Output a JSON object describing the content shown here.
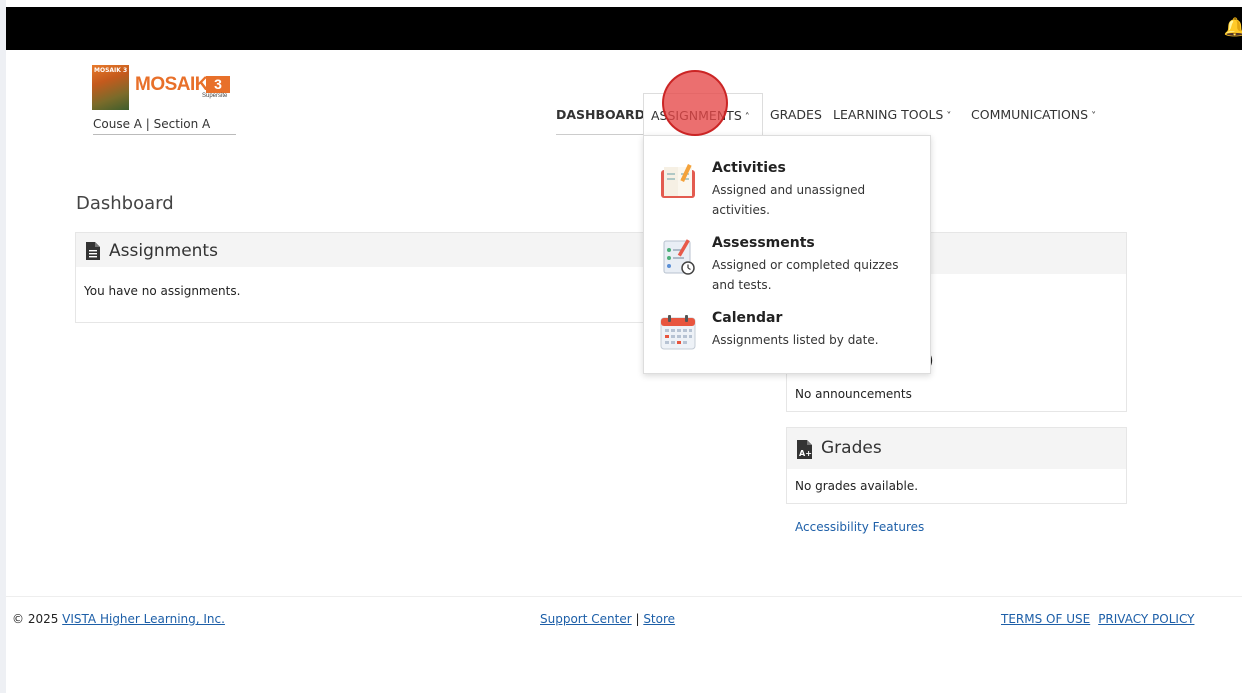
{
  "header": {
    "logo_cover_text": "MOSAIK 3",
    "brand_name": "MOSAIK",
    "brand_number": "3",
    "brand_sub": "Supersite",
    "course_label": "Couse A | Section A"
  },
  "nav": {
    "dashboard": "DASHBOARD",
    "assignments": "ASSIGNMENTS",
    "grades": "GRADES",
    "learning_tools": "LEARNING TOOLS",
    "communications": "COMMUNICATIONS"
  },
  "dropdown": {
    "items": [
      {
        "title": "Activities",
        "desc": "Assigned and unassigned activities.",
        "icon": "activities-book-icon"
      },
      {
        "title": "Assessments",
        "desc": "Assigned or completed quizzes and tests.",
        "icon": "assessments-checklist-icon"
      },
      {
        "title": "Calendar",
        "desc": "Assignments listed by date.",
        "icon": "calendar-icon"
      }
    ]
  },
  "main": {
    "page_title": "Dashboard",
    "assignments_panel": {
      "title": "Assignments",
      "empty": "You have no assignments."
    },
    "announcements_panel": {
      "title_fragment": ")",
      "empty": "No announcements"
    },
    "grades_panel": {
      "title": "Grades",
      "empty": "No grades available."
    },
    "accessibility_link": "Accessibility Features"
  },
  "footer": {
    "copyright_prefix": "© 2025 ",
    "company_link": "VISTA Higher Learning, Inc.",
    "support_link": "Support Center",
    "separator": " | ",
    "store_link": "Store",
    "terms_link": "TERMS OF USE",
    "privacy_link": "PRIVACY POLICY"
  },
  "colors": {
    "brand_orange": "#e8702a",
    "link_blue": "#1d5fa8",
    "click_indicator": "#e64646"
  }
}
